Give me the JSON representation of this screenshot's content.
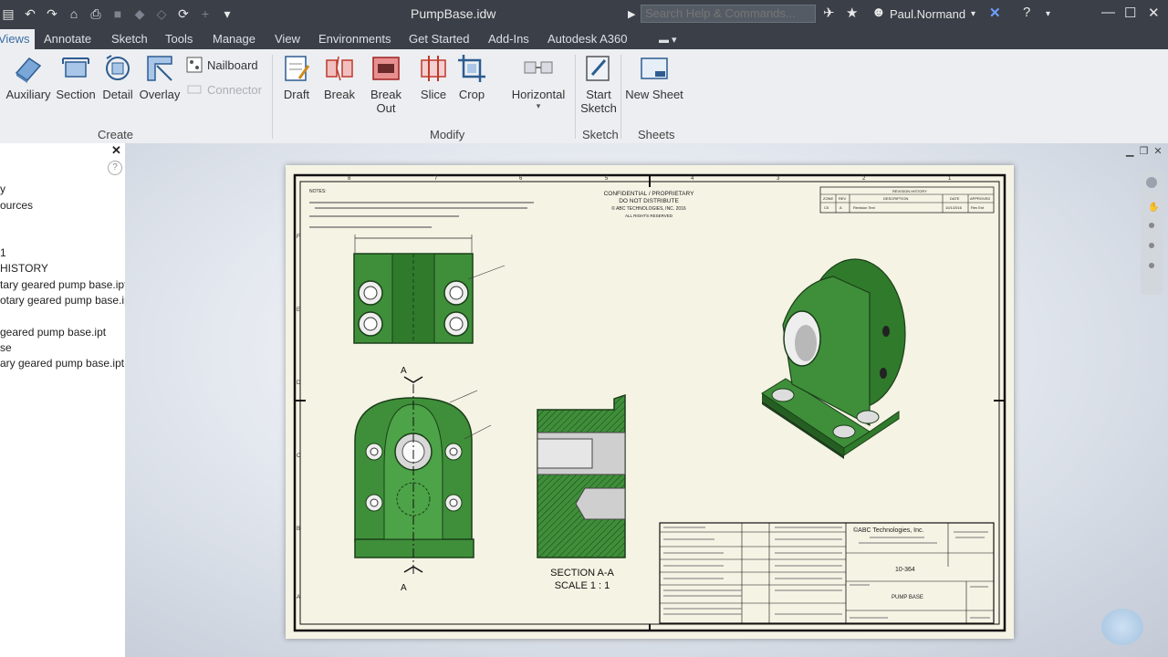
{
  "title_bar": {
    "document_title": "PumpBase.idw",
    "search_placeholder": "Search Help & Commands...",
    "user_name": "Paul.Normand"
  },
  "ribbon_tabs": [
    "Views",
    "Annotate",
    "Sketch",
    "Tools",
    "Manage",
    "View",
    "Environments",
    "Get Started",
    "Add-Ins",
    "Autodesk A360"
  ],
  "ribbon": {
    "create": {
      "label": "Create",
      "buttons": [
        "Auxiliary",
        "Section",
        "Detail",
        "Overlay"
      ],
      "small_buttons": [
        "Nailboard",
        "Connector"
      ]
    },
    "modify": {
      "label": "Modify",
      "buttons": [
        "Draft",
        "Break",
        "Break Out",
        "Slice",
        "Crop",
        "Horizontal"
      ]
    },
    "sketch": {
      "label": "Sketch",
      "button_line1": "Start",
      "button_line2": "Sketch"
    },
    "sheets": {
      "label": "Sheets",
      "button": "New Sheet"
    }
  },
  "browser": {
    "items": [
      "y",
      "ources",
      "",
      "1",
      "HISTORY",
      "tary geared pump base.ipt",
      "otary geared pump base.ipt",
      "",
      "geared pump base.ipt",
      "se",
      "ary geared pump base.ipt"
    ]
  },
  "drawing": {
    "header_line1": "CONFIDENTIAL / PROPRIETARY",
    "header_line2": "DO NOT DISTRIBUTE",
    "header_line3": "© ABC TECHNOLOGIES, INC. 2016",
    "header_line4": "ALL RIGHTS RESERVED",
    "notes_label": "NOTES:",
    "section_title": "SECTION A-A",
    "section_scale": "SCALE 1 : 1",
    "section_marker": "A",
    "company": "©ABC Technologies, Inc.",
    "drawing_number": "10-364",
    "part_name": "PUMP BASE",
    "revisions_label": "REVISION HISTORY",
    "rev_headers": [
      "ZONE",
      "REV",
      "DESCRIPTION",
      "DATE",
      "APPROVED"
    ],
    "rev_row": [
      "C5",
      "A",
      "Revision Text",
      "10/1/2016",
      "Rev Ent"
    ],
    "border_numbers": [
      "8",
      "7",
      "6",
      "5",
      "4",
      "3",
      "2",
      "1"
    ],
    "border_letters": [
      "F",
      "E",
      "D",
      "C",
      "B",
      "A"
    ]
  },
  "colors": {
    "titlebar_bg": "#3a3f48",
    "ribbon_bg": "#eceef1",
    "part_green": "#3f8f3a",
    "part_green_dark": "#245f22",
    "sheet_bg": "#f5f3e4"
  }
}
